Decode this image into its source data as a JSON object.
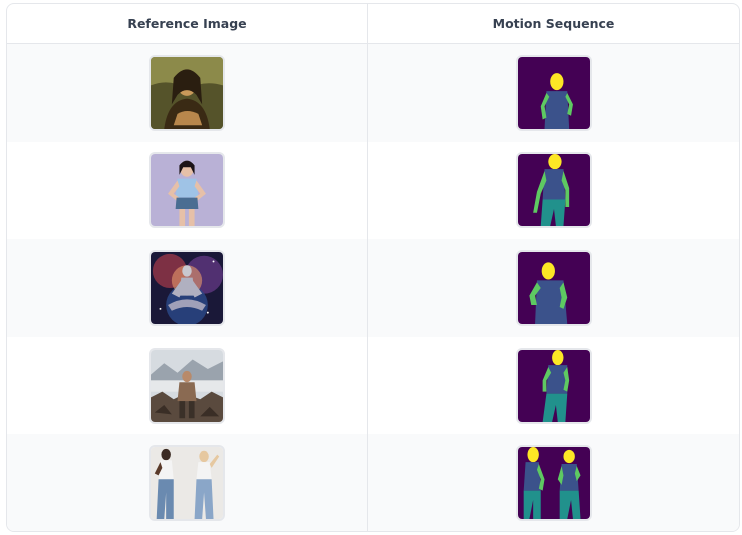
{
  "table": {
    "headers": [
      "Reference Image",
      "Motion Sequence"
    ],
    "rows": [
      {
        "reference": "mona-lisa-portrait-image",
        "motion": "motion-sequence-1-image"
      },
      {
        "reference": "woman-hands-on-hips-image",
        "motion": "motion-sequence-2-image"
      },
      {
        "reference": "cosmic-meditation-figure-image",
        "motion": "motion-sequence-3-image"
      },
      {
        "reference": "man-on-rocky-mountain-image",
        "motion": "motion-sequence-4-image"
      },
      {
        "reference": "two-women-dancing-image",
        "motion": "motion-sequence-5-image"
      }
    ]
  },
  "colors": {
    "motion_bg": "#440154",
    "head": "#fde725",
    "torso": "#3b528b",
    "arms": "#5ec962",
    "legs": "#21918c",
    "border": "#e5e7eb",
    "header_text": "#374151"
  }
}
